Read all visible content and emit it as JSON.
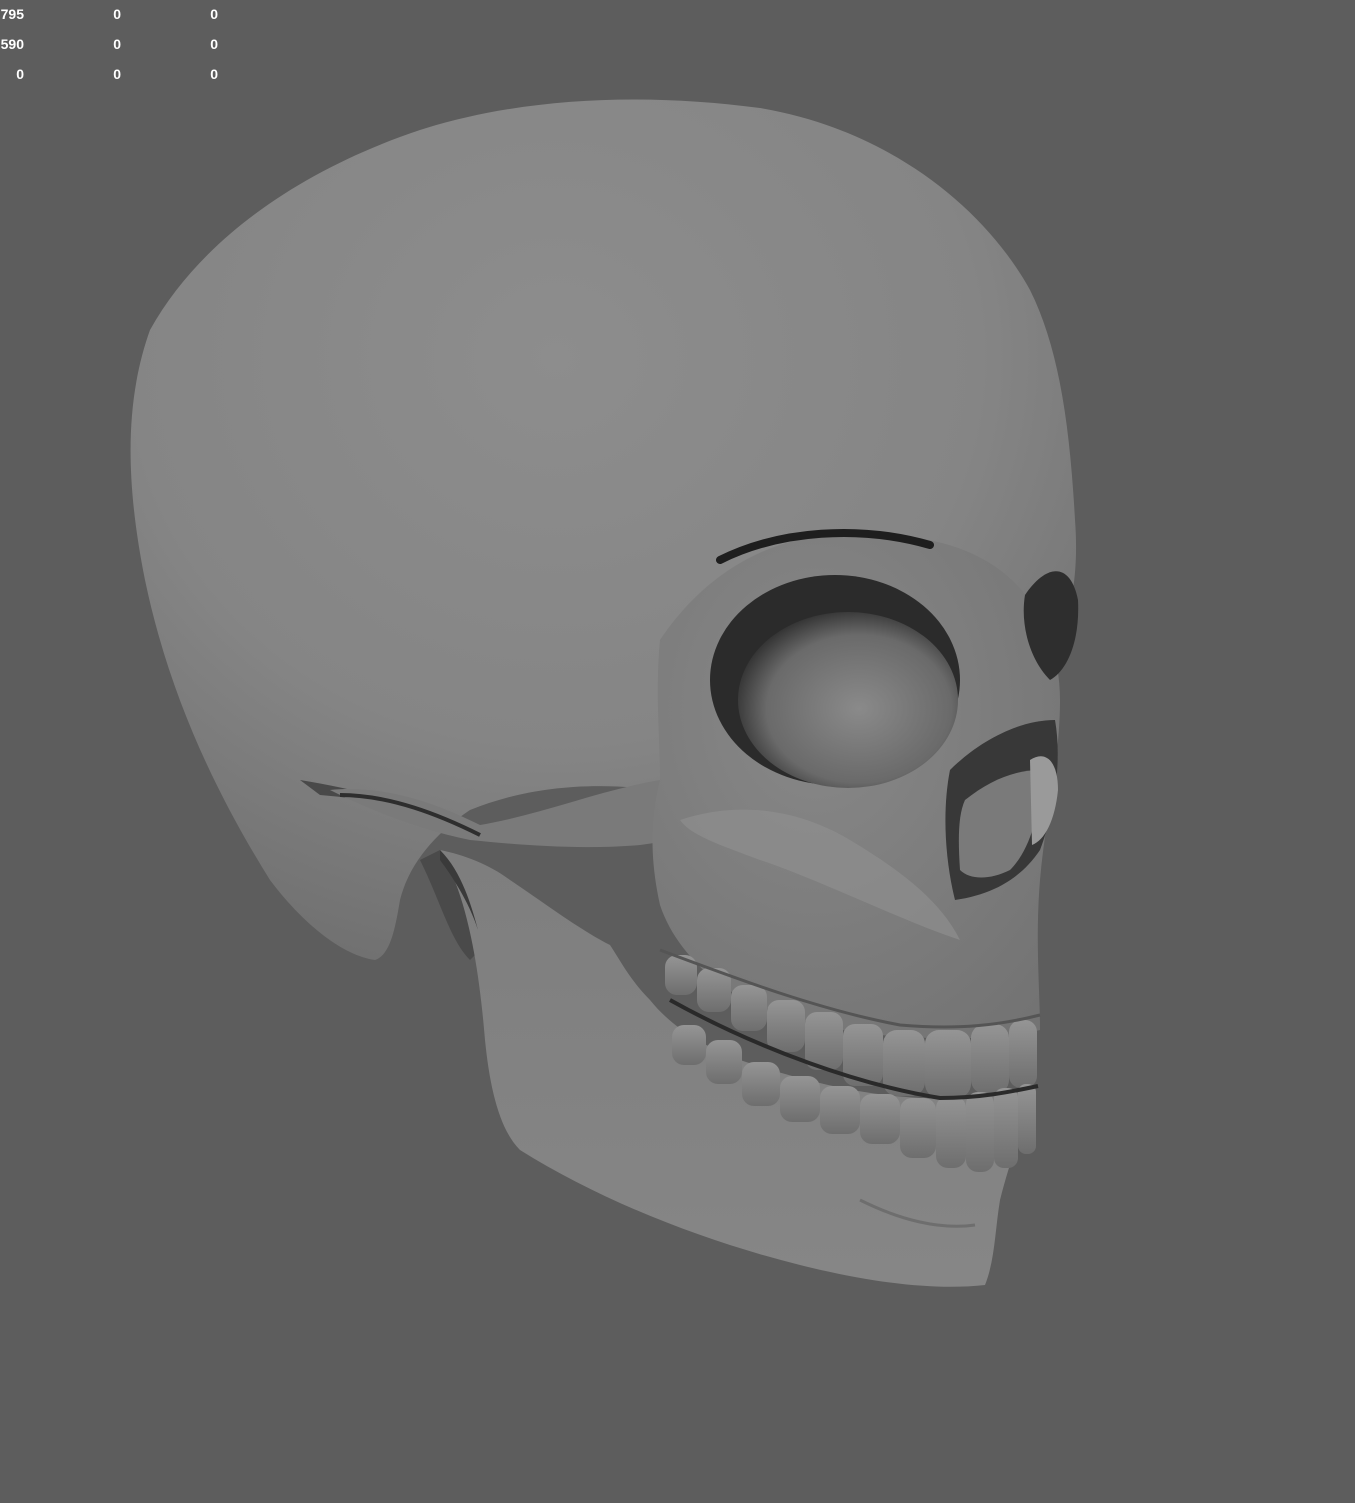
{
  "viewport": {
    "background_color": "#5d5d5d",
    "model_color": "#8a8a8a",
    "model_name_icon": "skull-model"
  },
  "hud": {
    "rows": [
      [
        "795",
        "0",
        "0"
      ],
      [
        "590",
        "0",
        "0"
      ],
      [
        "0",
        "0",
        "0"
      ]
    ]
  }
}
